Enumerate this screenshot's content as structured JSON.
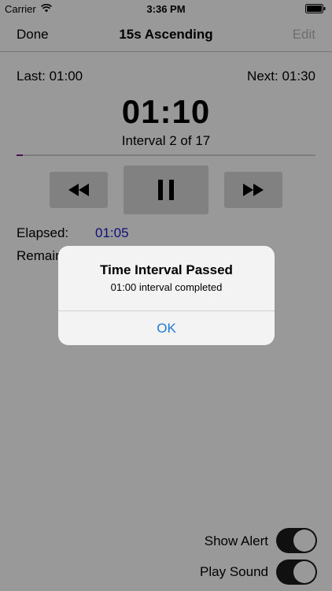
{
  "status_bar": {
    "carrier": "Carrier",
    "time": "3:36 PM"
  },
  "nav": {
    "done_label": "Done",
    "title": "15s Ascending",
    "edit_label": "Edit"
  },
  "timer": {
    "last": "Last: 01:00",
    "next": "Next: 01:30",
    "current": "01:10",
    "interval": "Interval 2 of 17",
    "progress": 0.02
  },
  "stats": {
    "elapsed_label": "Elapsed:",
    "elapsed_value": "01:05",
    "remaining_label": "Remair"
  },
  "toggles": [
    {
      "label": "Show Alert",
      "on": true
    },
    {
      "label": "Play Sound",
      "on": true
    }
  ],
  "alert": {
    "title": "Time Interval Passed",
    "message": "01:00 interval completed",
    "ok_label": "OK"
  },
  "colors": {
    "progress": "#7a1e8c",
    "elapsed": "#1818c8",
    "ok": "#1a7ad4"
  },
  "icons": [
    "wifi-icon",
    "battery-icon",
    "rewind-icon",
    "pause-icon",
    "fast-forward-icon"
  ]
}
